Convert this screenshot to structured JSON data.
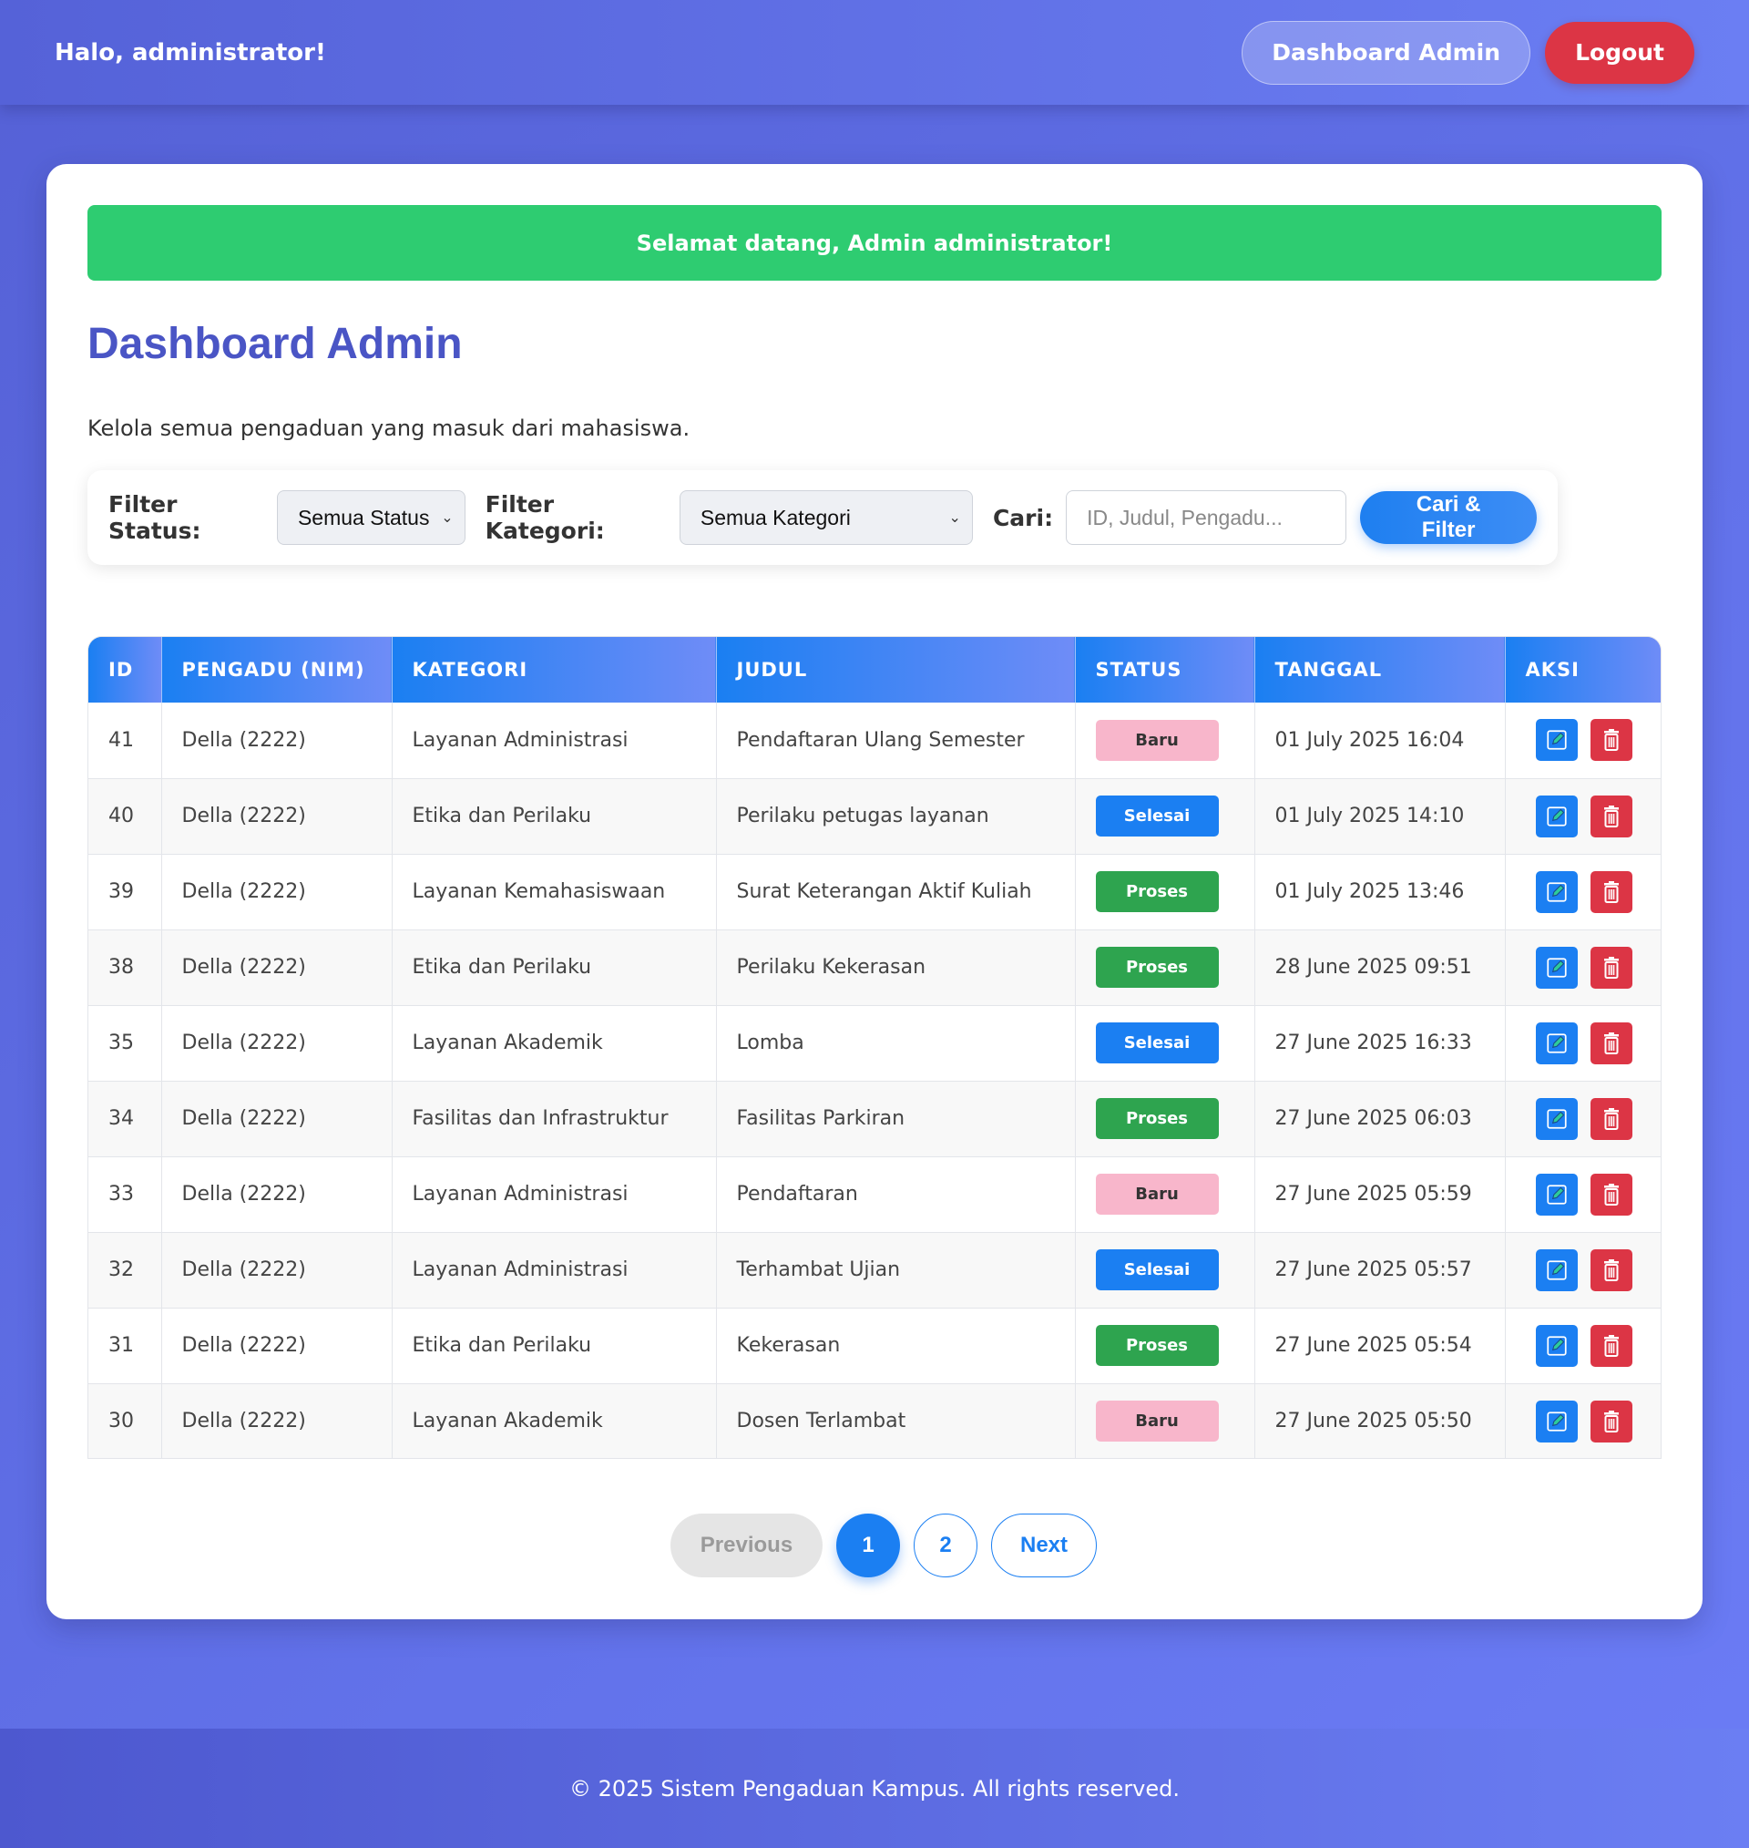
{
  "header": {
    "greeting": "Halo, administrator!",
    "dashboard_button": "Dashboard Admin",
    "logout_button": "Logout"
  },
  "alert": {
    "message": "Selamat datang, Admin administrator!"
  },
  "page": {
    "title": "Dashboard Admin",
    "subtitle": "Kelola semua pengaduan yang masuk dari mahasiswa."
  },
  "filters": {
    "status_label": "Filter Status:",
    "status_value": "Semua Status",
    "kategori_label": "Filter Kategori:",
    "kategori_value": "Semua Kategori",
    "search_label": "Cari:",
    "search_placeholder": "ID, Judul, Pengadu...",
    "submit_label": "Cari & Filter"
  },
  "table": {
    "columns": [
      "ID",
      "PENGADU (NIM)",
      "KATEGORI",
      "JUDUL",
      "STATUS",
      "TANGGAL",
      "AKSI"
    ],
    "rows": [
      {
        "id": "41",
        "pengadu": "Della (2222)",
        "kategori": "Layanan Administrasi",
        "judul": "Pendaftaran Ulang Semester",
        "status": "Baru",
        "tanggal": "01 July 2025 16:04"
      },
      {
        "id": "40",
        "pengadu": "Della (2222)",
        "kategori": "Etika dan Perilaku",
        "judul": "Perilaku petugas layanan",
        "status": "Selesai",
        "tanggal": "01 July 2025 14:10"
      },
      {
        "id": "39",
        "pengadu": "Della (2222)",
        "kategori": "Layanan Kemahasiswaan",
        "judul": "Surat Keterangan Aktif Kuliah",
        "status": "Proses",
        "tanggal": "01 July 2025 13:46"
      },
      {
        "id": "38",
        "pengadu": "Della (2222)",
        "kategori": "Etika dan Perilaku",
        "judul": "Perilaku Kekerasan",
        "status": "Proses",
        "tanggal": "28 June 2025 09:51"
      },
      {
        "id": "35",
        "pengadu": "Della (2222)",
        "kategori": "Layanan Akademik",
        "judul": "Lomba",
        "status": "Selesai",
        "tanggal": "27 June 2025 16:33"
      },
      {
        "id": "34",
        "pengadu": "Della (2222)",
        "kategori": "Fasilitas dan Infrastruktur",
        "judul": "Fasilitas Parkiran",
        "status": "Proses",
        "tanggal": "27 June 2025 06:03"
      },
      {
        "id": "33",
        "pengadu": "Della (2222)",
        "kategori": "Layanan Administrasi",
        "judul": "Pendaftaran",
        "status": "Baru",
        "tanggal": "27 June 2025 05:59"
      },
      {
        "id": "32",
        "pengadu": "Della (2222)",
        "kategori": "Layanan Administrasi",
        "judul": "Terhambat Ujian",
        "status": "Selesai",
        "tanggal": "27 June 2025 05:57"
      },
      {
        "id": "31",
        "pengadu": "Della (2222)",
        "kategori": "Etika dan Perilaku",
        "judul": "Kekerasan",
        "status": "Proses",
        "tanggal": "27 June 2025 05:54"
      },
      {
        "id": "30",
        "pengadu": "Della (2222)",
        "kategori": "Layanan Akademik",
        "judul": "Dosen Terlambat",
        "status": "Baru",
        "tanggal": "27 June 2025 05:50"
      }
    ],
    "row_actions": {
      "edit_icon": "edit-icon",
      "delete_icon": "trash-icon"
    }
  },
  "pagination": {
    "previous": "Previous",
    "pages": [
      "1",
      "2"
    ],
    "active_page": "1",
    "next": "Next"
  },
  "footer": {
    "text": "© 2025 Sistem Pengaduan Kampus. All rights reserved."
  },
  "colors": {
    "brand": "#5a66dc",
    "title": "#4a55c5",
    "success": "#2ecc71",
    "primary": "#1b7ff2",
    "danger": "#dc3545",
    "status_baru": "#f8b6cb",
    "status_proses": "#2ea44f",
    "status_selesai": "#1b7ff2"
  }
}
